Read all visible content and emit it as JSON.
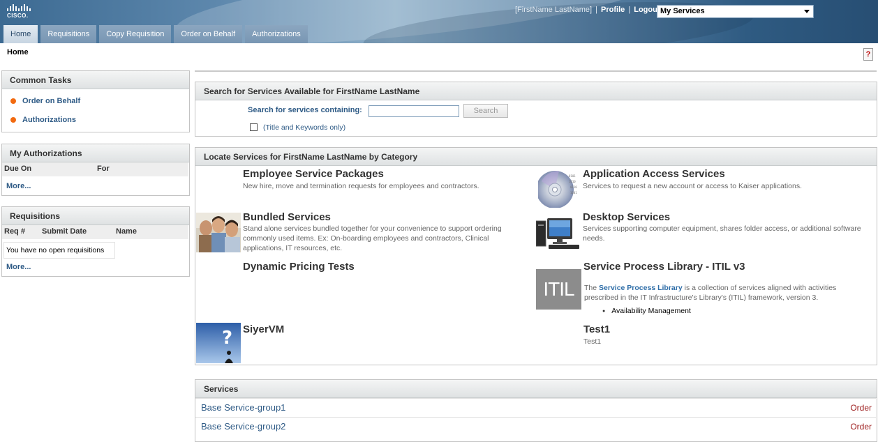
{
  "header": {
    "logo_text": "CISCO.",
    "user_name": "[FirstName LastName]",
    "profile_label": "Profile",
    "logout_label": "Logout",
    "separator": "|",
    "service_select": "My Services"
  },
  "tabs": [
    {
      "label": "Home"
    },
    {
      "label": "Requisitions"
    },
    {
      "label": "Copy Requisition"
    },
    {
      "label": "Order on Behalf"
    },
    {
      "label": "Authorizations"
    }
  ],
  "breadcrumb": "Home",
  "help_label": "?",
  "common_tasks": {
    "title": "Common Tasks",
    "items": [
      {
        "label": "Order on Behalf"
      },
      {
        "label": "Authorizations"
      }
    ]
  },
  "my_authorizations": {
    "title": "My Authorizations",
    "columns": [
      "Due On",
      "For"
    ],
    "more_label": "More..."
  },
  "requisitions": {
    "title": "Requisitions",
    "columns": [
      "Req #",
      "Submit Date",
      "Name"
    ],
    "empty_text": "You have no open requisitions",
    "more_label": "More..."
  },
  "search": {
    "title": "Search for Services Available for FirstName LastName",
    "label": "Search for services containing:",
    "value": "",
    "button_label": "Search",
    "checkbox_label": "(Title and Keywords only)"
  },
  "categories": {
    "title": "Locate Services for FirstName LastName by Category",
    "items": [
      {
        "title": "Employee Service Packages",
        "desc": "New hire, move and termination requests for employees and contractors."
      },
      {
        "title": "Application Access Services",
        "desc": "Services to request a new account or access to Kaiser applications."
      },
      {
        "title": "Bundled Services",
        "desc": "Stand alone services bundled together for your convenience to support ordering commonly used items. Ex: On-boarding employees and contractors, Clinical applications, IT resources, etc."
      },
      {
        "title": "Desktop Services",
        "desc": "Services supporting computer equipment, shares folder access, or additional software needs."
      },
      {
        "title": "Dynamic Pricing Tests",
        "desc": ""
      },
      {
        "title": "Service Process Library - ITIL v3",
        "desc_pre": "The ",
        "desc_link": "Service Process Library",
        "desc_post": " is a collection of services aligned with activities prescribed in the IT Infrastructure's Library's (ITIL) framework, version 3.",
        "bullet": "Availability Management",
        "image_text": "ITIL"
      },
      {
        "title": "SiyerVM",
        "desc": ""
      },
      {
        "title": "Test1",
        "desc": "Test1"
      }
    ]
  },
  "services": {
    "title": "Services",
    "rows": [
      {
        "name": "Base Service-group1",
        "action": "Order"
      },
      {
        "name": "Base Service-group2",
        "action": "Order"
      }
    ]
  }
}
